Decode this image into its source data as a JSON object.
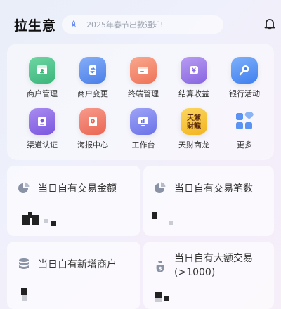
{
  "header": {
    "title": "拉生意",
    "notice": "2025年春节出款通知!"
  },
  "menu": [
    {
      "label": "商户管理",
      "icon": "merchant-icon",
      "color": "#4fc08d"
    },
    {
      "label": "商户变更",
      "icon": "exchange-icon",
      "color": "#5b8ff0"
    },
    {
      "label": "终端管理",
      "icon": "terminal-icon",
      "color": "#f5876c"
    },
    {
      "label": "结算收益",
      "icon": "settlement-icon",
      "color": "#9a7ce8"
    },
    {
      "label": "银行活动",
      "icon": "bank-activity-icon",
      "color": "#4d8ff5"
    },
    {
      "label": "渠道认证",
      "icon": "certify-icon",
      "color": "#8a6ae6"
    },
    {
      "label": "海报中心",
      "icon": "poster-icon",
      "color": "#f0766a"
    },
    {
      "label": "工作台",
      "icon": "workbench-icon",
      "color": "#7a82ee"
    },
    {
      "label": "天财商龙",
      "icon": "tiancai-logo-icon",
      "color": "#f7c53d",
      "logo_text": "天鼐\n財龍"
    },
    {
      "label": "更多",
      "icon": "more-grid-icon",
      "color": "#4d8ff5"
    }
  ],
  "stats": [
    {
      "title": "当日自有交易金额",
      "icon": "pie-chart-icon"
    },
    {
      "title": "当日自有交易笔数",
      "icon": "pie-chart-icon"
    },
    {
      "title": "当日自有新增商户",
      "icon": "database-icon"
    },
    {
      "title": "当日自有大额交易(>1000)",
      "icon": "money-bag-icon"
    }
  ]
}
